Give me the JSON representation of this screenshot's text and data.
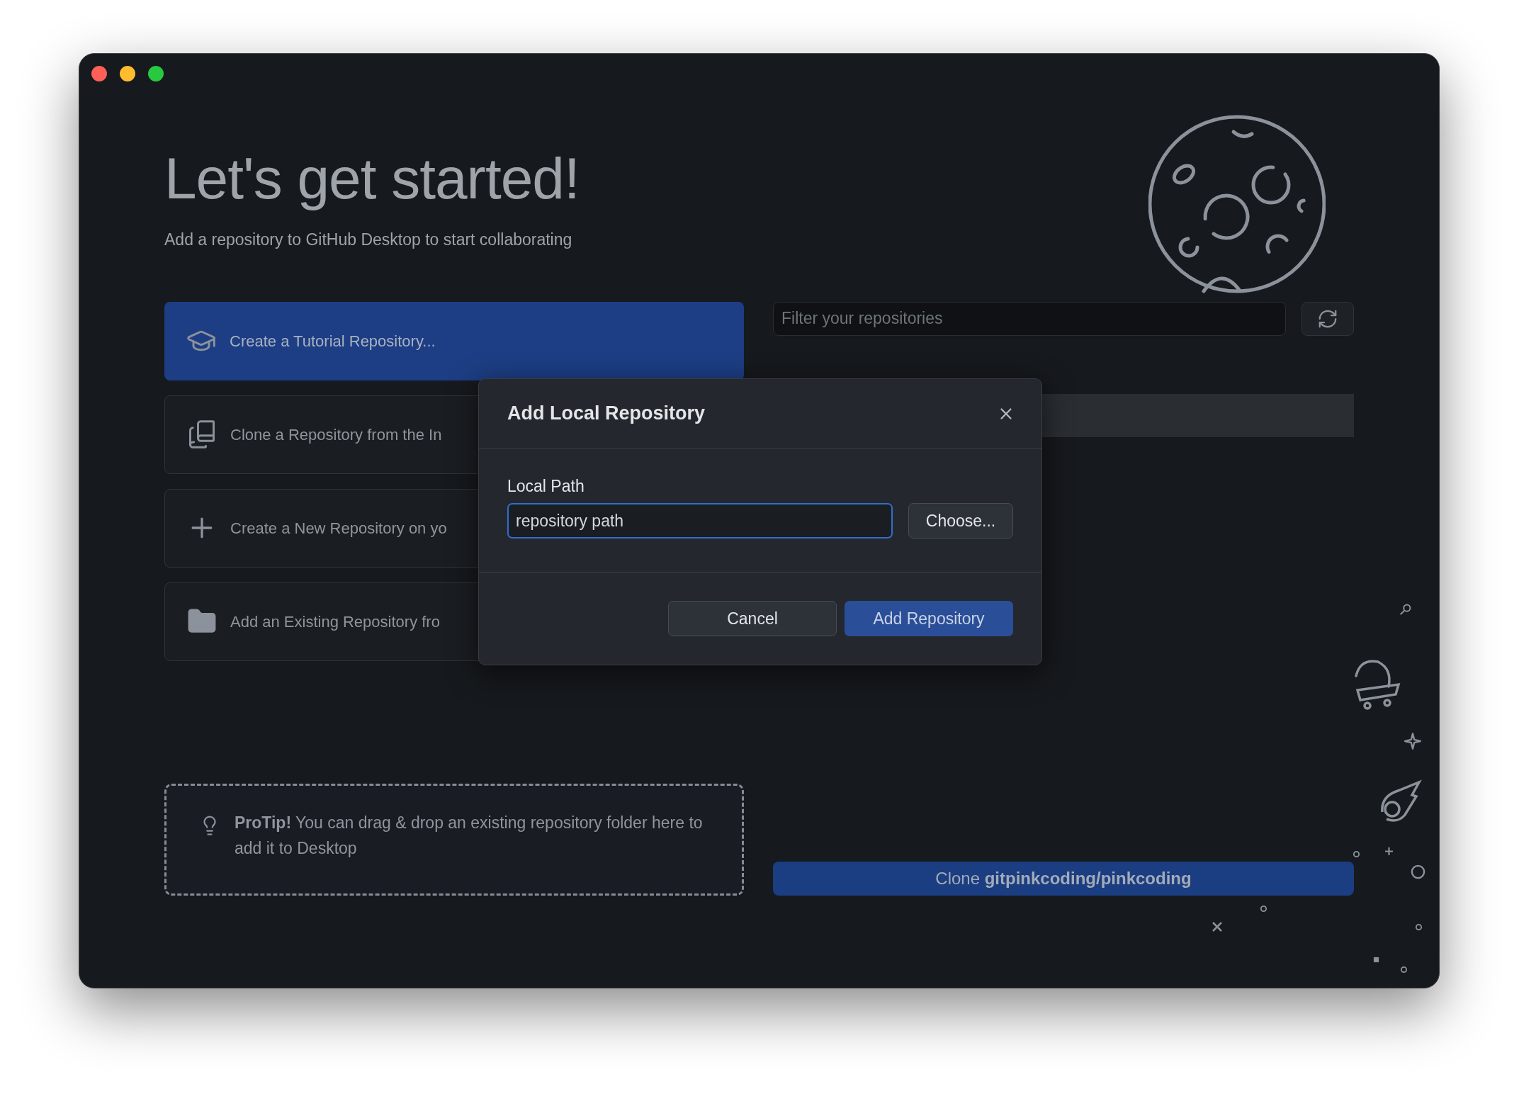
{
  "header": {
    "title": "Let's get started!",
    "subtitle": "Add a repository to GitHub Desktop to start collaborating"
  },
  "actions": [
    {
      "kind": "tutorial",
      "label": "Create a Tutorial Repository...",
      "selected": true
    },
    {
      "kind": "clone",
      "label": "Clone a Repository from the In",
      "selected": false
    },
    {
      "kind": "create",
      "label": "Create a New Repository on yo",
      "selected": false
    },
    {
      "kind": "add",
      "label": "Add an Existing Repository fro",
      "selected": false
    }
  ],
  "protip": {
    "text": "**ProTip!** You can drag & drop an existing repository folder here to add it to Desktop"
  },
  "repositories": {
    "filter": {
      "placeholder": "Filter your repositories"
    },
    "rows": [
      {
        "selected": true
      }
    ]
  },
  "clone_button": {
    "label": "Clone **gitpinkcoding/pinkcoding**"
  },
  "dialog": {
    "title": "Add Local Repository",
    "field": {
      "label": "Local Path",
      "value": "repository path"
    },
    "choose_button": "Choose...",
    "buttons": [
      {
        "kind": "secondary",
        "label": "Cancel"
      },
      {
        "kind": "primary",
        "label": "Add Repository"
      }
    ]
  }
}
